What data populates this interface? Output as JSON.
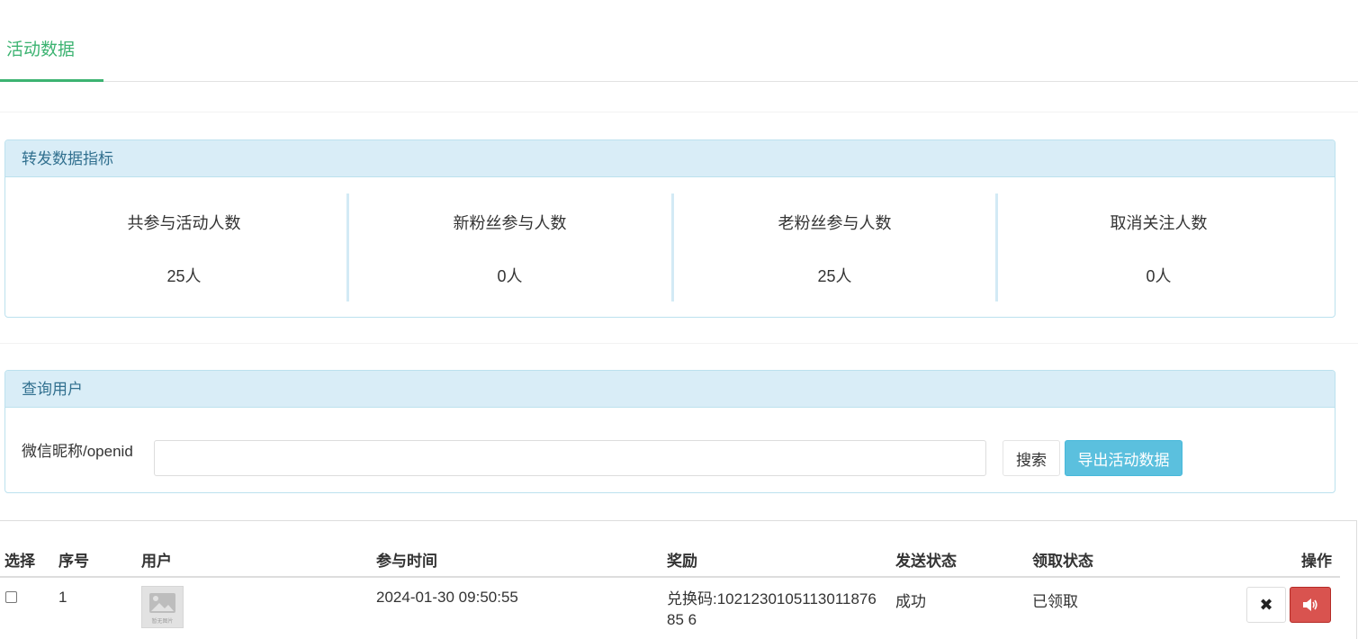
{
  "tabs": [
    {
      "label": "活动数据",
      "active": true
    }
  ],
  "stats_panel": {
    "title": "转发数据指标",
    "items": [
      {
        "label": "共参与活动人数",
        "value": "25人"
      },
      {
        "label": "新粉丝参与人数",
        "value": "0人"
      },
      {
        "label": "老粉丝参与人数",
        "value": "25人"
      },
      {
        "label": "取消关注人数",
        "value": "0人"
      }
    ]
  },
  "search_panel": {
    "title": "查询用户",
    "field_label": "微信昵称/openid",
    "input_value": "",
    "search_label": "搜索",
    "export_label": "导出活动数据"
  },
  "table": {
    "headers": {
      "select": "选择",
      "index": "序号",
      "user": "用户",
      "time": "参与时间",
      "reward": "奖励",
      "send_status": "发送状态",
      "claim_status": "领取状态",
      "actions": "操作"
    },
    "rows": [
      {
        "index": "1",
        "avatar_placeholder": "暂无图片",
        "time": "2024-01-30 09:50:55",
        "reward": "兑换码:102123010511301187685 6",
        "send_status": "成功",
        "claim_status": "已领取",
        "actions": [
          "close-icon",
          "volume-icon"
        ]
      }
    ]
  },
  "colors": {
    "accent_green": "#3cb371",
    "panel_head_bg": "#d9edf7",
    "panel_head_text": "#31708f",
    "info_button": "#5bc0de",
    "danger_button": "#d9534f"
  }
}
